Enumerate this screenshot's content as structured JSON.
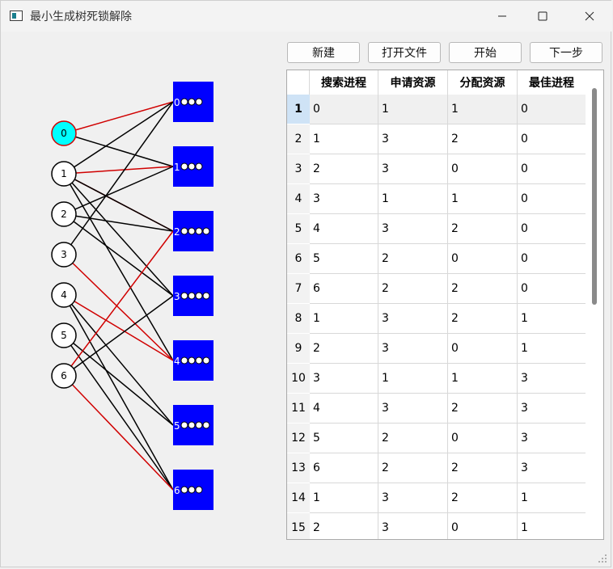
{
  "window": {
    "title": "最小生成树死锁解除"
  },
  "toolbar": {
    "new_label": "新建",
    "open_label": "打开文件",
    "start_label": "开始",
    "next_label": "下一步"
  },
  "graph": {
    "processes": [
      "0",
      "1",
      "2",
      "3",
      "4",
      "5",
      "6"
    ],
    "resources": [
      {
        "id": "0",
        "units": 3
      },
      {
        "id": "1",
        "units": 3
      },
      {
        "id": "2",
        "units": 4
      },
      {
        "id": "3",
        "units": 4
      },
      {
        "id": "4",
        "units": 4
      },
      {
        "id": "5",
        "units": 4
      },
      {
        "id": "6",
        "units": 3
      }
    ],
    "highlight_process": "0",
    "colors": {
      "process_fill": "#ffffff",
      "highlight_fill": "#00ffff",
      "resource_fill": "#0000ff",
      "request_edge": "#d00000",
      "alloc_edge": "#000000"
    },
    "edges": [
      {
        "p": 0,
        "r": 0,
        "c": "red"
      },
      {
        "p": 0,
        "r": 1,
        "c": "black"
      },
      {
        "p": 1,
        "r": 1,
        "c": "red"
      },
      {
        "p": 1,
        "r": 2,
        "c": "red"
      },
      {
        "p": 1,
        "r": 2,
        "c": "black"
      },
      {
        "p": 1,
        "r": 3,
        "c": "black"
      },
      {
        "p": 1,
        "r": 4,
        "c": "black"
      },
      {
        "p": 1,
        "r": 0,
        "c": "black"
      },
      {
        "p": 2,
        "r": 1,
        "c": "black"
      },
      {
        "p": 2,
        "r": 2,
        "c": "black"
      },
      {
        "p": 2,
        "r": 3,
        "c": "black"
      },
      {
        "p": 3,
        "r": 0,
        "c": "black"
      },
      {
        "p": 3,
        "r": 4,
        "c": "red"
      },
      {
        "p": 4,
        "r": 4,
        "c": "red"
      },
      {
        "p": 4,
        "r": 5,
        "c": "black"
      },
      {
        "p": 4,
        "r": 6,
        "c": "black"
      },
      {
        "p": 5,
        "r": 5,
        "c": "black"
      },
      {
        "p": 5,
        "r": 6,
        "c": "black"
      },
      {
        "p": 6,
        "r": 2,
        "c": "red"
      },
      {
        "p": 6,
        "r": 3,
        "c": "black"
      },
      {
        "p": 6,
        "r": 6,
        "c": "red"
      }
    ]
  },
  "table": {
    "headers": [
      "搜索进程",
      "申请资源",
      "分配资源",
      "最佳进程"
    ],
    "selected_row": 0,
    "rows": [
      {
        "n": "1",
        "c": [
          "0",
          "1",
          "1",
          "0"
        ]
      },
      {
        "n": "2",
        "c": [
          "1",
          "3",
          "2",
          "0"
        ]
      },
      {
        "n": "3",
        "c": [
          "2",
          "3",
          "0",
          "0"
        ]
      },
      {
        "n": "4",
        "c": [
          "3",
          "1",
          "1",
          "0"
        ]
      },
      {
        "n": "5",
        "c": [
          "4",
          "3",
          "2",
          "0"
        ]
      },
      {
        "n": "6",
        "c": [
          "5",
          "2",
          "0",
          "0"
        ]
      },
      {
        "n": "7",
        "c": [
          "6",
          "2",
          "2",
          "0"
        ]
      },
      {
        "n": "8",
        "c": [
          "1",
          "3",
          "2",
          "1"
        ]
      },
      {
        "n": "9",
        "c": [
          "2",
          "3",
          "0",
          "1"
        ]
      },
      {
        "n": "10",
        "c": [
          "3",
          "1",
          "1",
          "3"
        ]
      },
      {
        "n": "11",
        "c": [
          "4",
          "3",
          "2",
          "3"
        ]
      },
      {
        "n": "12",
        "c": [
          "5",
          "2",
          "0",
          "3"
        ]
      },
      {
        "n": "13",
        "c": [
          "6",
          "2",
          "2",
          "3"
        ]
      },
      {
        "n": "14",
        "c": [
          "1",
          "3",
          "2",
          "1"
        ]
      },
      {
        "n": "15",
        "c": [
          "2",
          "3",
          "0",
          "1"
        ]
      }
    ]
  }
}
